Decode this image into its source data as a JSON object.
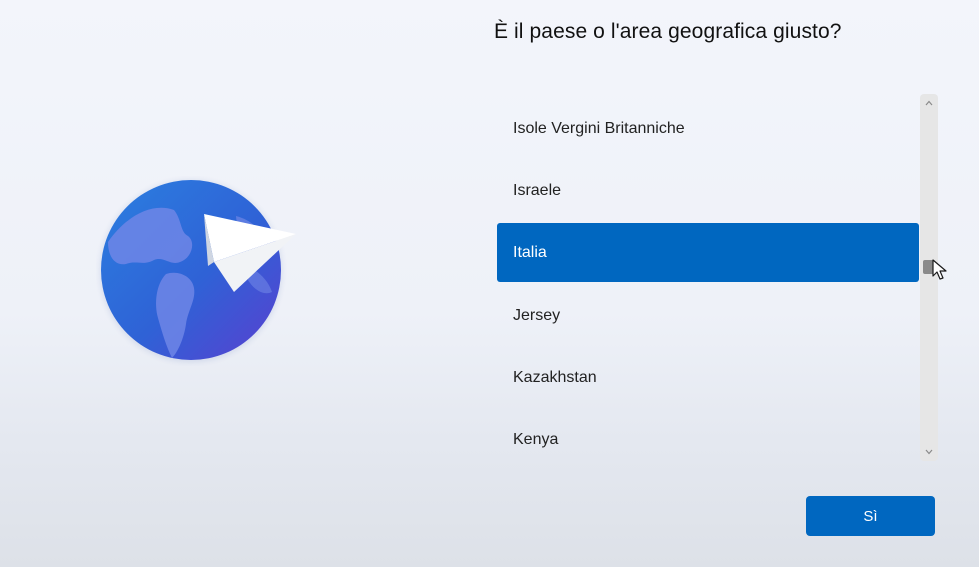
{
  "title": "È il paese o l'area geografica giusto?",
  "countries": [
    {
      "label": "Isole Vergini Britanniche",
      "selected": false
    },
    {
      "label": "Israele",
      "selected": false
    },
    {
      "label": "Italia",
      "selected": true
    },
    {
      "label": "Jersey",
      "selected": false
    },
    {
      "label": "Kazakhstan",
      "selected": false
    },
    {
      "label": "Kenya",
      "selected": false
    }
  ],
  "buttons": {
    "confirm_label": "Sì"
  },
  "colors": {
    "accent": "#0067c0",
    "selected_text": "#ffffff",
    "text": "#222222",
    "scrollbar_track": "#e6e6e6",
    "scrollbar_thumb": "#8a8a8a"
  },
  "icons": {
    "illustration": "globe-with-paper-plane-icon",
    "scroll_up": "chevron-up-icon",
    "scroll_down": "chevron-down-icon",
    "pointer": "mouse-cursor-icon"
  }
}
